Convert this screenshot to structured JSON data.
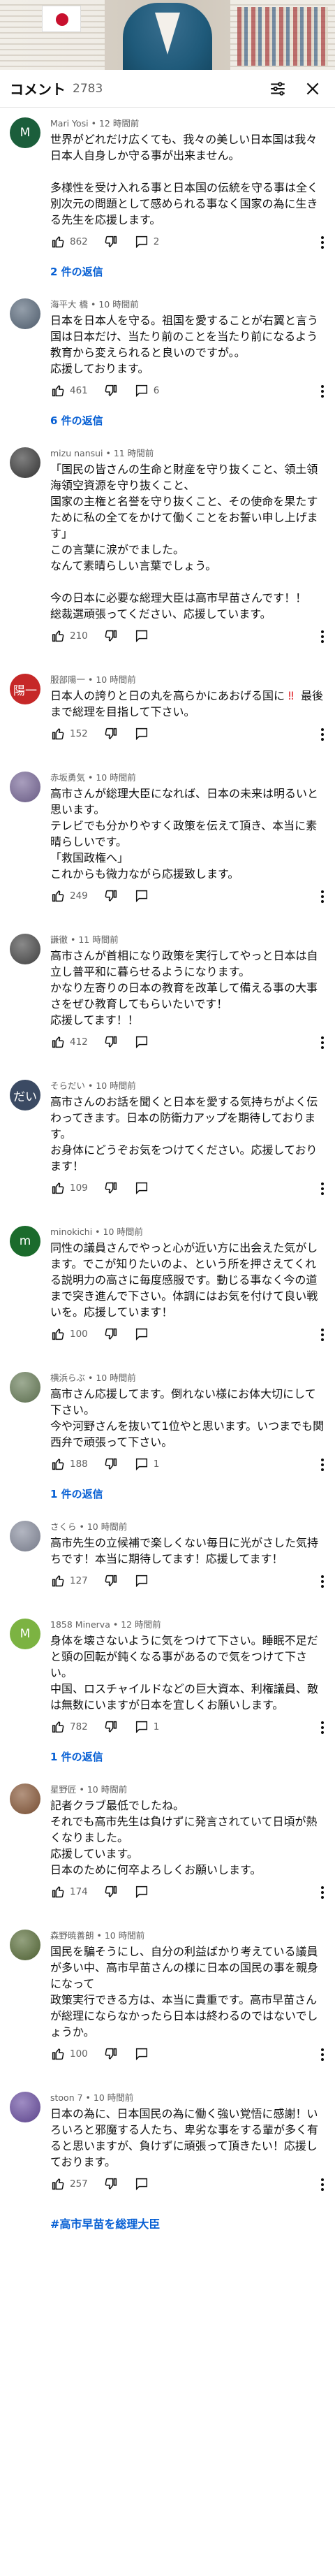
{
  "header": {
    "title": "コメント",
    "count": "2783"
  },
  "icons": {
    "like": "thumb-up-icon",
    "dislike": "thumb-down-icon",
    "reply": "comment-bubble-icon",
    "more": "more-vert-icon",
    "filter": "tune-icon",
    "close": "close-icon"
  },
  "colors": {
    "link_blue": "#065fd4",
    "meta_gray": "#606060"
  },
  "comments": [
    {
      "author": "Mari Yosi",
      "time": "12 時間前",
      "text": "世界がどれだけ広くても、我々の美しい日本国は我々日本人自身しか守る事が出来ません。\n\n多様性を受け入れる事と日本国の伝統を守る事は全く別次元の問題として感められる事なく国家の為に生きる先生を応援します。",
      "likes": "862",
      "replies_count": "2",
      "replies_link": "2 件の返信",
      "avatar_letter": "M",
      "avatar_color": "#1b5e3b"
    },
    {
      "author": "海平大 橋",
      "time": "10 時間前",
      "text": "日本を日本人を守る。祖国を愛することが右翼と言う国は日本だけ、当たり前のことを当たり前になるよう教育から変えられると良いのですが。。\n応援しております。",
      "likes": "461",
      "replies_count": "6",
      "replies_link": "6 件の返信",
      "avatar_letter": "",
      "avatar_color": "#5b6b7d"
    },
    {
      "author": "mizu nansui",
      "time": "11 時間前",
      "text": "「国民の皆さんの生命と財産を守り抜くこと、領土領海領空資源を守り抜くこと、\n国家の主権と名誉を守り抜くこと、その使命を果たすために私の全てをかけて働くことをお誓い申し上げます」\nこの言葉に涙がでました。\nなんて素晴らしい言葉でしょう。\n\n今の日本に必要な総理大臣は高市早苗さんです！！\n総裁選頑張ってください、応援しています。",
      "likes": "210",
      "replies_count": "",
      "replies_link": "",
      "avatar_letter": "",
      "avatar_color": "#3b3b3b"
    },
    {
      "author": "服部陽一",
      "time": "10 時間前",
      "text": "日本人の誇りと日の丸を高らかにあおげる国に",
      "text2": "最後まで総理を目指して下さい。",
      "emoji": "‼",
      "likes": "152",
      "replies_count": "",
      "replies_link": "",
      "avatar_letter": "陽一",
      "avatar_color": "#c62828"
    },
    {
      "author": "赤坂勇気",
      "time": "10 時間前",
      "text": "高市さんが総理大臣になれば、日本の未来は明るいと思います。\nテレビでも分かりやすく政策を伝えて頂き、本当に素晴らしいです。\n「救国政権へ」\nこれからも微力ながら応援致します。",
      "likes": "249",
      "replies_count": "",
      "replies_link": "",
      "avatar_letter": "",
      "avatar_color": "#7a6a9a"
    },
    {
      "author": "謙徹",
      "time": "11 時間前",
      "text": "高市さんが首相になり政策を実行してやっと日本は自立し普平和に暮らせるようになります。\nかなり左寄りの日本の教育を改革して備える事の大事さをぜひ教育してもらいたいです！\n応援してます！！",
      "likes": "412",
      "replies_count": "",
      "replies_link": "",
      "avatar_letter": "",
      "avatar_color": "#4a4a4a"
    },
    {
      "author": "そらだい",
      "time": "10 時間前",
      "text": "高市さんのお話を聞くと日本を愛する気持ちがよく伝わってきます。日本の防衛力アップを期待しております。\nお身体にどうぞお気をつけてください。応援しております！",
      "likes": "109",
      "replies_count": "",
      "replies_link": "",
      "avatar_letter": "だい",
      "avatar_color": "#3b4a63"
    },
    {
      "author": "minokichi",
      "time": "10 時間前",
      "text": "同性の議員さんでやっと心が近い方に出会えた気がします。でこが知りたいのよ、という所を押さえてくれる説明力の高さに毎度感服です。動じる事なく今の道まで突き進んで下さい。体調にはお気を付けて良い戦いを。応援しています！",
      "likes": "100",
      "replies_count": "",
      "replies_link": "",
      "avatar_letter": "m",
      "avatar_color": "#1b6b2c"
    },
    {
      "author": "横浜らぶ",
      "time": "10 時間前",
      "text": "高市さん応援してます。倒れない様にお体大切にして下さい。\n今や河野さんを抜いて1位やと思います。いつまでも関西弁で頑張って下さい。",
      "likes": "188",
      "replies_count": "1",
      "replies_link": "1 件の返信",
      "avatar_letter": "",
      "avatar_color": "#6a7f5a"
    },
    {
      "author": "さくら",
      "time": "10 時間前",
      "text": "高市先生の立候補で楽しくない毎日に光がさした気持ちです！本当に期待してます！応援してます！",
      "likes": "127",
      "replies_count": "",
      "replies_link": "",
      "avatar_letter": "",
      "avatar_color": "#8a8fa0"
    },
    {
      "author": "1858 Minerva",
      "time": "12 時間前",
      "text": "身体を壊さないように気をつけて下さい。睡眠不足だと頭の回転が鈍くなる事があるので気をつけて下さい。\n中国、ロスチャイルドなどの巨大資本、利権議員、敵は無数にいますが日本を宜しくお願いします。",
      "likes": "782",
      "replies_count": "1",
      "replies_link": "1 件の返信",
      "avatar_letter": "M",
      "avatar_color": "#7cb342"
    },
    {
      "author": "星野匠",
      "time": "10 時間前",
      "text": "記者クラブ最低でしたね。\nそれでも高市先生は負けずに発言されていて日頃が熱くなりました。\n応援しています。\n日本のために何卒よろしくお願いします。",
      "likes": "174",
      "replies_count": "",
      "replies_link": "",
      "avatar_letter": "",
      "avatar_color": "#8a5a3a"
    },
    {
      "author": "森野暁善朗",
      "time": "10 時間前",
      "text": "国民を騙そうにし、自分の利益ばかり考えている議員が多い中、高市早苗さんの様に日本の国民の事を親身になって\n政策実行できる方は、本当に貴重です。高市早苗さんが総理にならなかったら日本は終わるのではないでしょうか。",
      "likes": "100",
      "replies_count": "",
      "replies_link": "",
      "avatar_letter": "",
      "avatar_color": "#5a6f3a"
    },
    {
      "author": "stoon 7",
      "time": "10 時間前",
      "text": "日本の為に、日本国民の為に働く強い覚悟に感謝！いろいろと邪魔する人たち、卑劣な事をする輩が多く有ると思いますが、負けずに頑張って頂きたい！応援しております。",
      "likes": "257",
      "replies_count": "",
      "replies_link": "",
      "hashtag": "#高市早苗を総理大臣",
      "avatar_letter": "",
      "avatar_color": "#6b4fa3"
    }
  ]
}
